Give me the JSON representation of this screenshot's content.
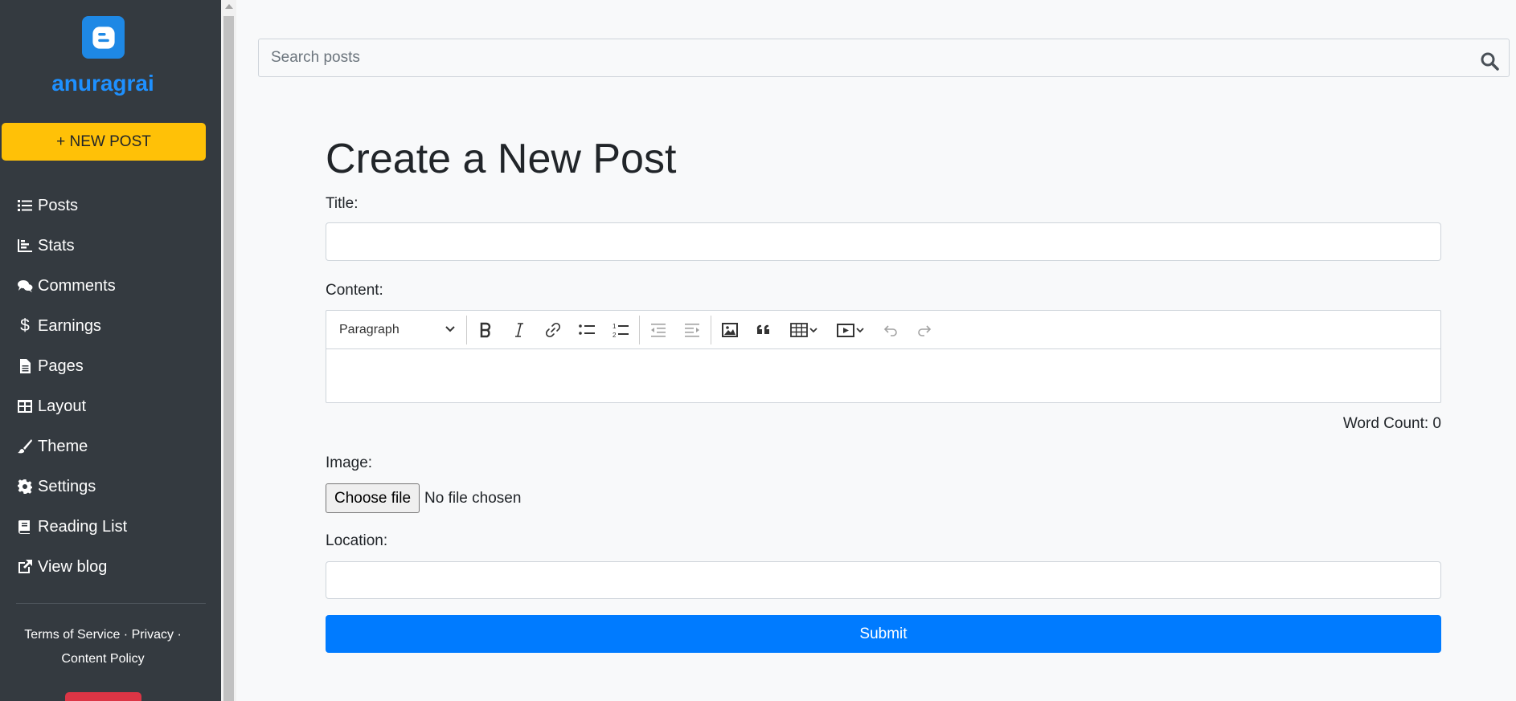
{
  "sidebar": {
    "brand": "anuragrai",
    "new_post_label": "+ NEW POST",
    "items": [
      {
        "label": "Posts",
        "icon": "list-icon"
      },
      {
        "label": "Stats",
        "icon": "chart-icon"
      },
      {
        "label": "Comments",
        "icon": "comments-icon"
      },
      {
        "label": "Earnings",
        "icon": "dollar-icon"
      },
      {
        "label": "Pages",
        "icon": "page-icon"
      },
      {
        "label": "Layout",
        "icon": "layout-icon"
      },
      {
        "label": "Theme",
        "icon": "brush-icon"
      },
      {
        "label": "Settings",
        "icon": "gear-icon"
      },
      {
        "label": "Reading List",
        "icon": "book-icon"
      },
      {
        "label": "View blog",
        "icon": "external-link-icon"
      }
    ],
    "footer": {
      "terms": "Terms of Service",
      "sep": " · ",
      "privacy": "Privacy",
      "content_policy": "Content Policy"
    }
  },
  "search": {
    "placeholder": "Search posts"
  },
  "form": {
    "title": "Create a New Post",
    "title_label": "Title:",
    "content_label": "Content:",
    "editor": {
      "paragraph_label": "Paragraph"
    },
    "word_count": "Word Count: 0",
    "image_label": "Image:",
    "choose_file": "Choose file",
    "file_status": "No file chosen",
    "location_label": "Location:",
    "submit_label": "Submit"
  },
  "colors": {
    "sidebar_bg": "#343a40",
    "brand": "#1e90ff",
    "new_post": "#ffc107",
    "submit": "#007bff"
  }
}
